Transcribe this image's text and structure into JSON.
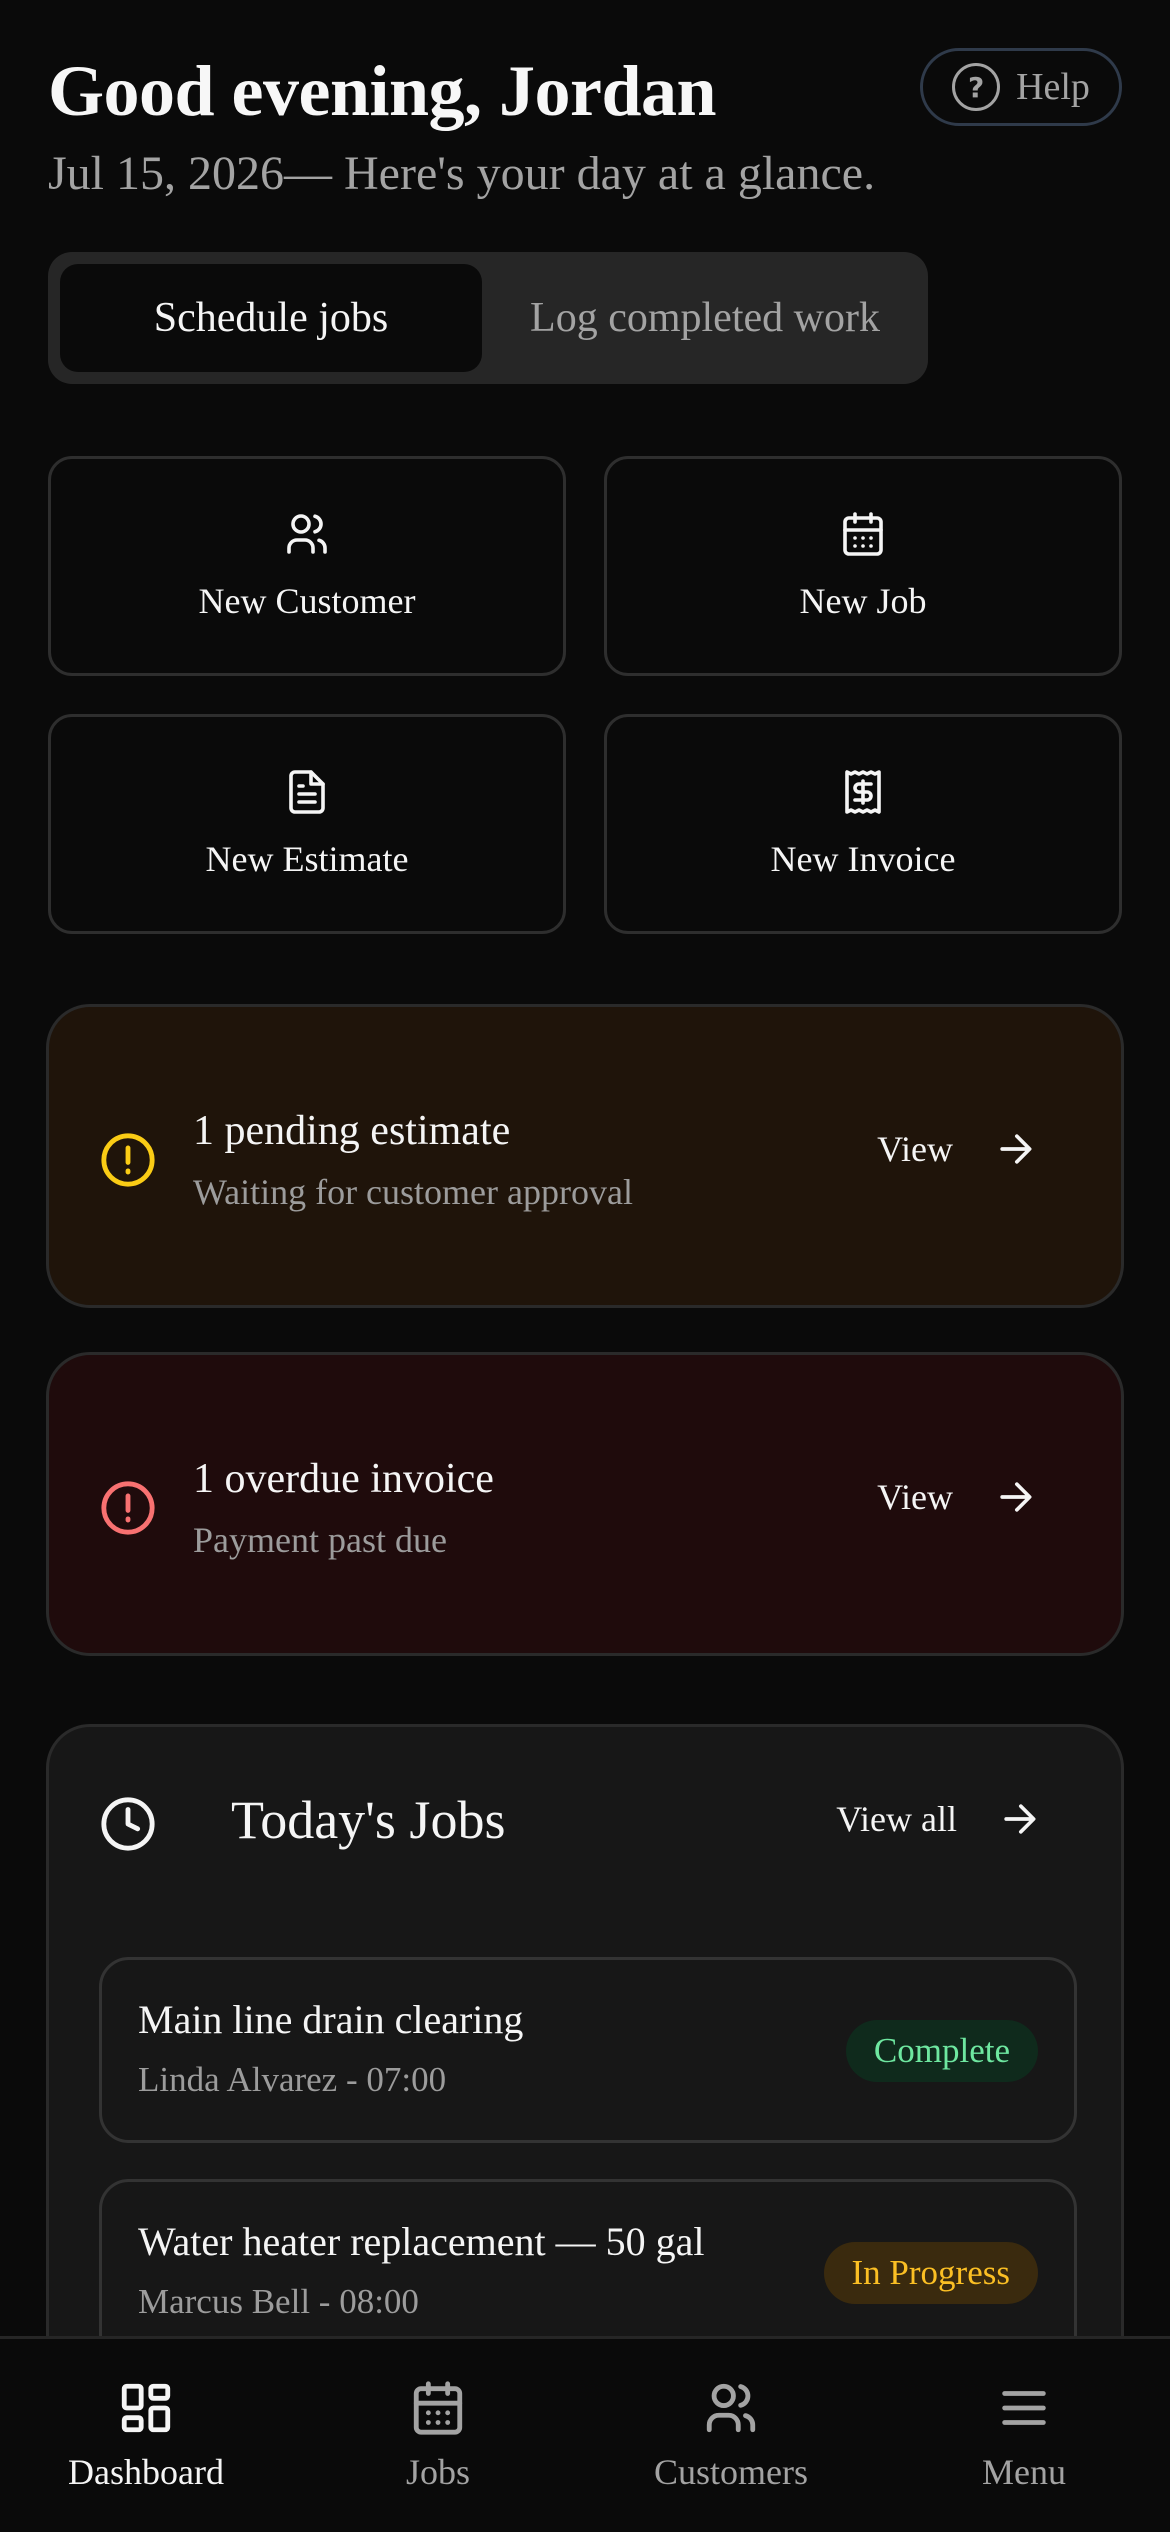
{
  "header": {
    "greeting": "Good evening, Jordan",
    "subtitle": "Jul 15, 2026— Here's your day at a glance.",
    "help_label": "Help",
    "help_icon": "question-circle-icon"
  },
  "mode_toggle": {
    "options": [
      "Schedule jobs",
      "Log completed work"
    ],
    "selected": "Schedule jobs"
  },
  "quick_actions": [
    {
      "label": "New Customer",
      "icon": "users-icon"
    },
    {
      "label": "New Job",
      "icon": "calendar-icon"
    },
    {
      "label": "New Estimate",
      "icon": "document-icon"
    },
    {
      "label": "New Invoice",
      "icon": "receipt-dollar-icon"
    }
  ],
  "alerts": {
    "estimate": {
      "title": "1 pending estimate",
      "subtitle": "Waiting for customer approval",
      "action": "View",
      "color": "#facc15"
    },
    "invoice": {
      "title": "1 overdue invoice",
      "subtitle": "Payment past due",
      "action": "View",
      "color": "#f87171"
    }
  },
  "todays_jobs": {
    "title": "Today's Jobs",
    "view_all": "View all",
    "jobs": [
      {
        "title": "Main line drain clearing",
        "subtitle": "Linda Alvarez - 07:00",
        "status": "Complete"
      },
      {
        "title": "Water heater replacement — 50 gal",
        "subtitle": "Marcus Bell - 08:00",
        "status": "In Progress"
      }
    ]
  },
  "bottom_nav": {
    "items": [
      {
        "label": "Dashboard",
        "icon": "grid-icon"
      },
      {
        "label": "Jobs",
        "icon": "calendar-icon"
      },
      {
        "label": "Customers",
        "icon": "users-icon"
      },
      {
        "label": "Menu",
        "icon": "hamburger-icon"
      }
    ],
    "active": "Dashboard"
  }
}
